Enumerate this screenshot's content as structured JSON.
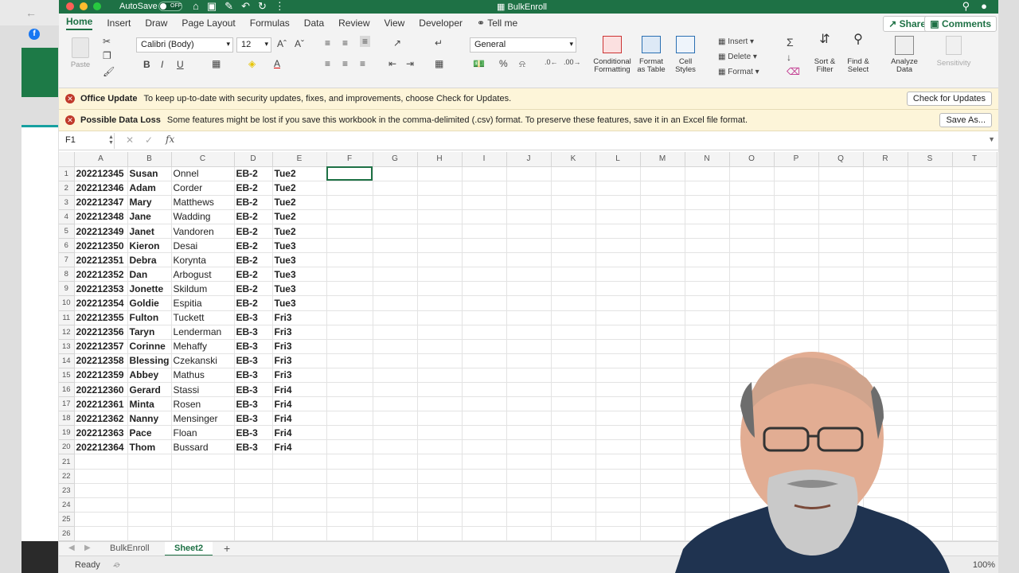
{
  "window": {
    "title": "BulkEnroll",
    "autosave_label": "AutoSave",
    "autosave_state": "OFF"
  },
  "tabs": [
    {
      "label": "Home",
      "active": true
    },
    {
      "label": "Insert"
    },
    {
      "label": "Draw"
    },
    {
      "label": "Page Layout"
    },
    {
      "label": "Formulas"
    },
    {
      "label": "Data"
    },
    {
      "label": "Review"
    },
    {
      "label": "View"
    },
    {
      "label": "Developer"
    },
    {
      "label": "Tell me"
    }
  ],
  "header_buttons": {
    "share": "Share",
    "comments": "Comments"
  },
  "ribbon": {
    "paste": "Paste",
    "font_name": "Calibri (Body)",
    "font_size": "12",
    "number_format": "General",
    "conditional_formatting": [
      "Conditional",
      "Formatting"
    ],
    "format_as_table": [
      "Format",
      "as Table"
    ],
    "cell_styles": [
      "Cell",
      "Styles"
    ],
    "insert": "Insert",
    "delete": "Delete",
    "format": "Format",
    "sort_filter": [
      "Sort &",
      "Filter"
    ],
    "find_select": [
      "Find &",
      "Select"
    ],
    "analyze_data": [
      "Analyze",
      "Data"
    ],
    "sensitivity": "Sensitivity"
  },
  "messages": [
    {
      "title": "Office Update",
      "text": "To keep up-to-date with security updates, fixes, and improvements, choose Check for Updates.",
      "button": "Check for Updates"
    },
    {
      "title": "Possible Data Loss",
      "text": "Some features might be lost if you save this workbook in the comma-delimited (.csv) format. To preserve these features, save it in an Excel file format.",
      "button": "Save As..."
    }
  ],
  "formula_bar": {
    "name_box": "F1",
    "fx": "fx",
    "value": ""
  },
  "columns": [
    "A",
    "B",
    "C",
    "D",
    "E",
    "F",
    "G",
    "H",
    "I",
    "J",
    "K",
    "L",
    "M",
    "N",
    "O",
    "P",
    "Q",
    "R",
    "S",
    "T"
  ],
  "rows": [
    [
      "202212345",
      "Susan",
      "Onnel",
      "EB-2",
      "Tue2"
    ],
    [
      "202212346",
      "Adam",
      "Corder",
      "EB-2",
      "Tue2"
    ],
    [
      "202212347",
      "Mary",
      "Matthews",
      "EB-2",
      "Tue2"
    ],
    [
      "202212348",
      "Jane",
      "Wadding",
      "EB-2",
      "Tue2"
    ],
    [
      "202212349",
      "Janet",
      "Vandoren",
      "EB-2",
      "Tue2"
    ],
    [
      "202212350",
      "Kieron",
      "Desai",
      "EB-2",
      "Tue3"
    ],
    [
      "202212351",
      "Debra",
      "Korynta",
      "EB-2",
      "Tue3"
    ],
    [
      "202212352",
      "Dan",
      "Arbogust",
      "EB-2",
      "Tue3"
    ],
    [
      "202212353",
      "Jonette",
      "Skildum",
      "EB-2",
      "Tue3"
    ],
    [
      "202212354",
      "Goldie",
      "Espitia",
      "EB-2",
      "Tue3"
    ],
    [
      "202212355",
      "Fulton",
      "Tuckett",
      "EB-3",
      "Fri3"
    ],
    [
      "202212356",
      "Taryn",
      "Lenderman",
      "EB-3",
      "Fri3"
    ],
    [
      "202212357",
      "Corinne",
      "Mehaffy",
      "EB-3",
      "Fri3"
    ],
    [
      "202212358",
      "Blessing",
      "Czekanski",
      "EB-3",
      "Fri3"
    ],
    [
      "202212359",
      "Abbey",
      "Mathus",
      "EB-3",
      "Fri3"
    ],
    [
      "202212360",
      "Gerard",
      "Stassi",
      "EB-3",
      "Fri4"
    ],
    [
      "202212361",
      "Minta",
      "Rosen",
      "EB-3",
      "Fri4"
    ],
    [
      "202212362",
      "Nanny",
      "Mensinger",
      "EB-3",
      "Fri4"
    ],
    [
      "202212363",
      "Pace",
      "Floan",
      "EB-3",
      "Fri4"
    ],
    [
      "202212364",
      "Thom",
      "Bussard",
      "EB-3",
      "Fri4"
    ]
  ],
  "total_rows": 28,
  "selected_cell": "F1",
  "sheets": [
    {
      "label": "BulkEnroll"
    },
    {
      "label": "Sheet2",
      "active": true
    }
  ],
  "status": {
    "ready": "Ready",
    "zoom": "100%"
  },
  "colors": {
    "accent": "#1e7145",
    "message_bg": "#fdf5d9"
  }
}
